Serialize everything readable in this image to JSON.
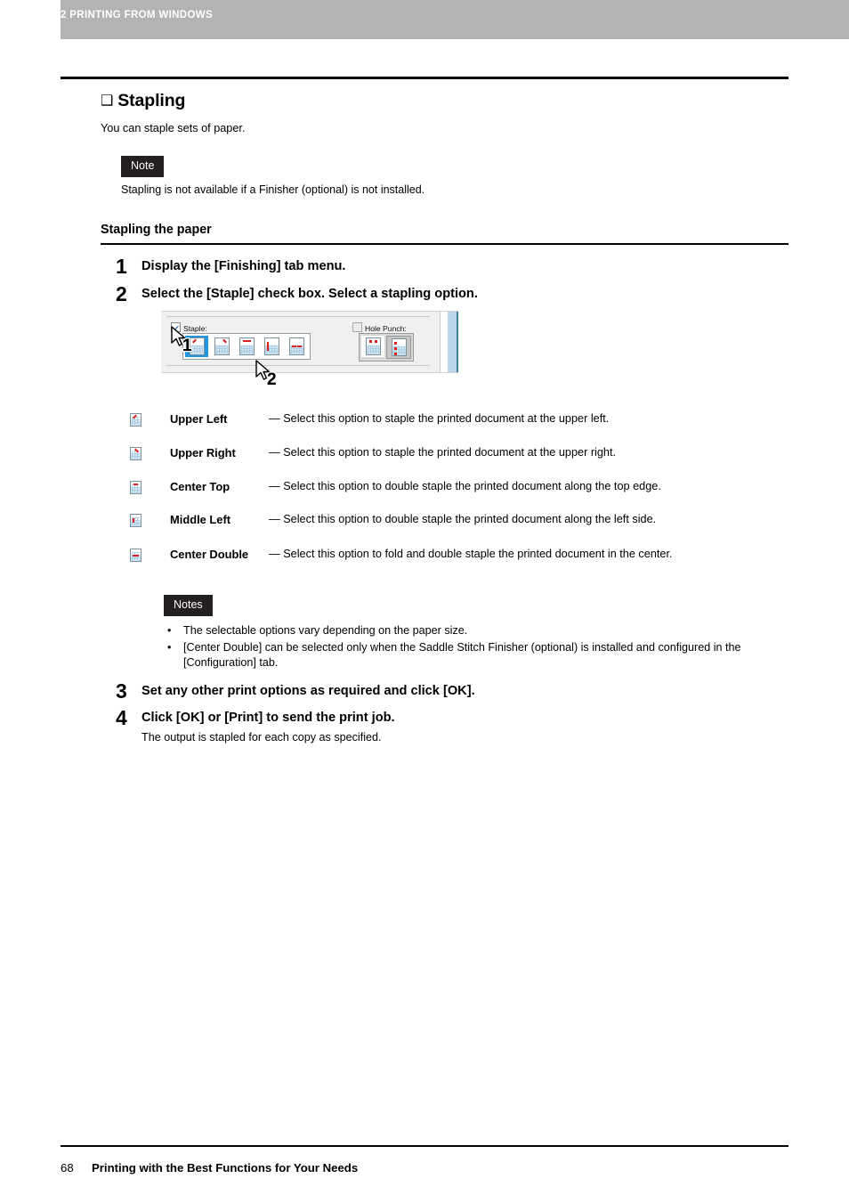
{
  "header": {
    "chapter_label": "2 PRINTING FROM WINDOWS",
    "bar_color": "#b3b3b3"
  },
  "section": {
    "box_glyph": "❑",
    "title": "Stapling",
    "intro": "You can staple sets of paper."
  },
  "note": {
    "badge": "Note",
    "badge_color": "#231f20",
    "text": "Stapling is not available if a Finisher (optional) is not installed."
  },
  "subheading": "Stapling the paper",
  "steps": [
    {
      "num": "1",
      "title": "Display the [Finishing] tab menu.",
      "sub": ""
    },
    {
      "num": "2",
      "title": "Select the [Staple] check box. Select a stapling option.",
      "sub": ""
    },
    {
      "num": "3",
      "title": "Set any other print options as required and click [OK].",
      "sub": ""
    },
    {
      "num": "4",
      "title": "Click [OK] or [Print] to send the print job.",
      "sub": "The output is stapled for each copy as specified."
    }
  ],
  "dialog": {
    "staple": {
      "label": "Staple:",
      "checked": true,
      "selected_index": 0,
      "buttons": [
        "upper-left",
        "upper-right",
        "center-top",
        "middle-left",
        "center-double"
      ]
    },
    "hole_punch": {
      "label": "Hole Punch:",
      "checked": false,
      "pressed_index": 1,
      "buttons": [
        "punch-top",
        "punch-left"
      ]
    },
    "callouts": [
      {
        "num": "1"
      },
      {
        "num": "2"
      }
    ],
    "highlight_color": "#2196dd",
    "scrollbar_color": "#b9d7ea"
  },
  "options": [
    {
      "icon": "staple-upper-left-icon",
      "name": "Upper Left",
      "desc": "— Select this option to staple the printed document at the upper left."
    },
    {
      "icon": "staple-upper-right-icon",
      "name": "Upper Right",
      "desc": "— Select this option to staple the printed document at the upper right."
    },
    {
      "icon": "staple-center-top-icon",
      "name": "Center Top",
      "desc": "— Select this option to double staple the printed document along the top edge."
    },
    {
      "icon": "staple-middle-left-icon",
      "name": "Middle Left",
      "desc": "— Select this option to double staple the printed document along the left side."
    },
    {
      "icon": "staple-center-double-icon",
      "name": "Center Double",
      "desc": "— Select this option to fold and double staple the printed document in the center."
    }
  ],
  "notes": {
    "badge": "Notes",
    "items": [
      "The selectable options vary depending on the paper size.",
      "[Center Double] can be selected only when the Saddle Stitch Finisher (optional) is installed and configured in the [Configuration] tab."
    ]
  },
  "footer": {
    "page_number": "68",
    "text": "Printing with the Best Functions for Your Needs"
  }
}
